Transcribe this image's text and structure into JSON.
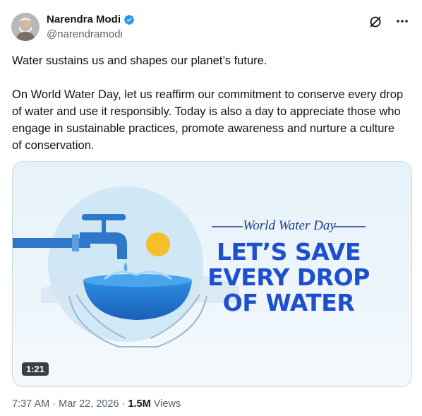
{
  "author": {
    "display_name": "Narendra Modi",
    "handle": "@narendramodi",
    "verified_icon": "verified-badge-icon"
  },
  "tweet": {
    "paragraphs": [
      "Water sustains us and shapes our planet’s future.",
      "On World Water Day, let us reaffirm our commitment to conserve every drop of water and use it responsibly. Today is also a day to appreciate those who engage in sustainable practices, promote awareness and nurture a culture of conservation."
    ]
  },
  "media": {
    "subtitle": "World Water Day",
    "headline_lines": [
      "LET’S SAVE",
      "EVERY DROP",
      "OF WATER"
    ],
    "duration": "1:21"
  },
  "meta": {
    "time": "7:37 AM",
    "separator": "·",
    "date": "Mar 22, 2026",
    "views_count": "1.5M",
    "views_label": "Views"
  },
  "colors": {
    "verified": "#1d9bf0",
    "headline": "#1d4fcf",
    "muted_text": "#536471"
  },
  "icons": {
    "grok": "grok-icon",
    "more": "more-options-icon"
  }
}
